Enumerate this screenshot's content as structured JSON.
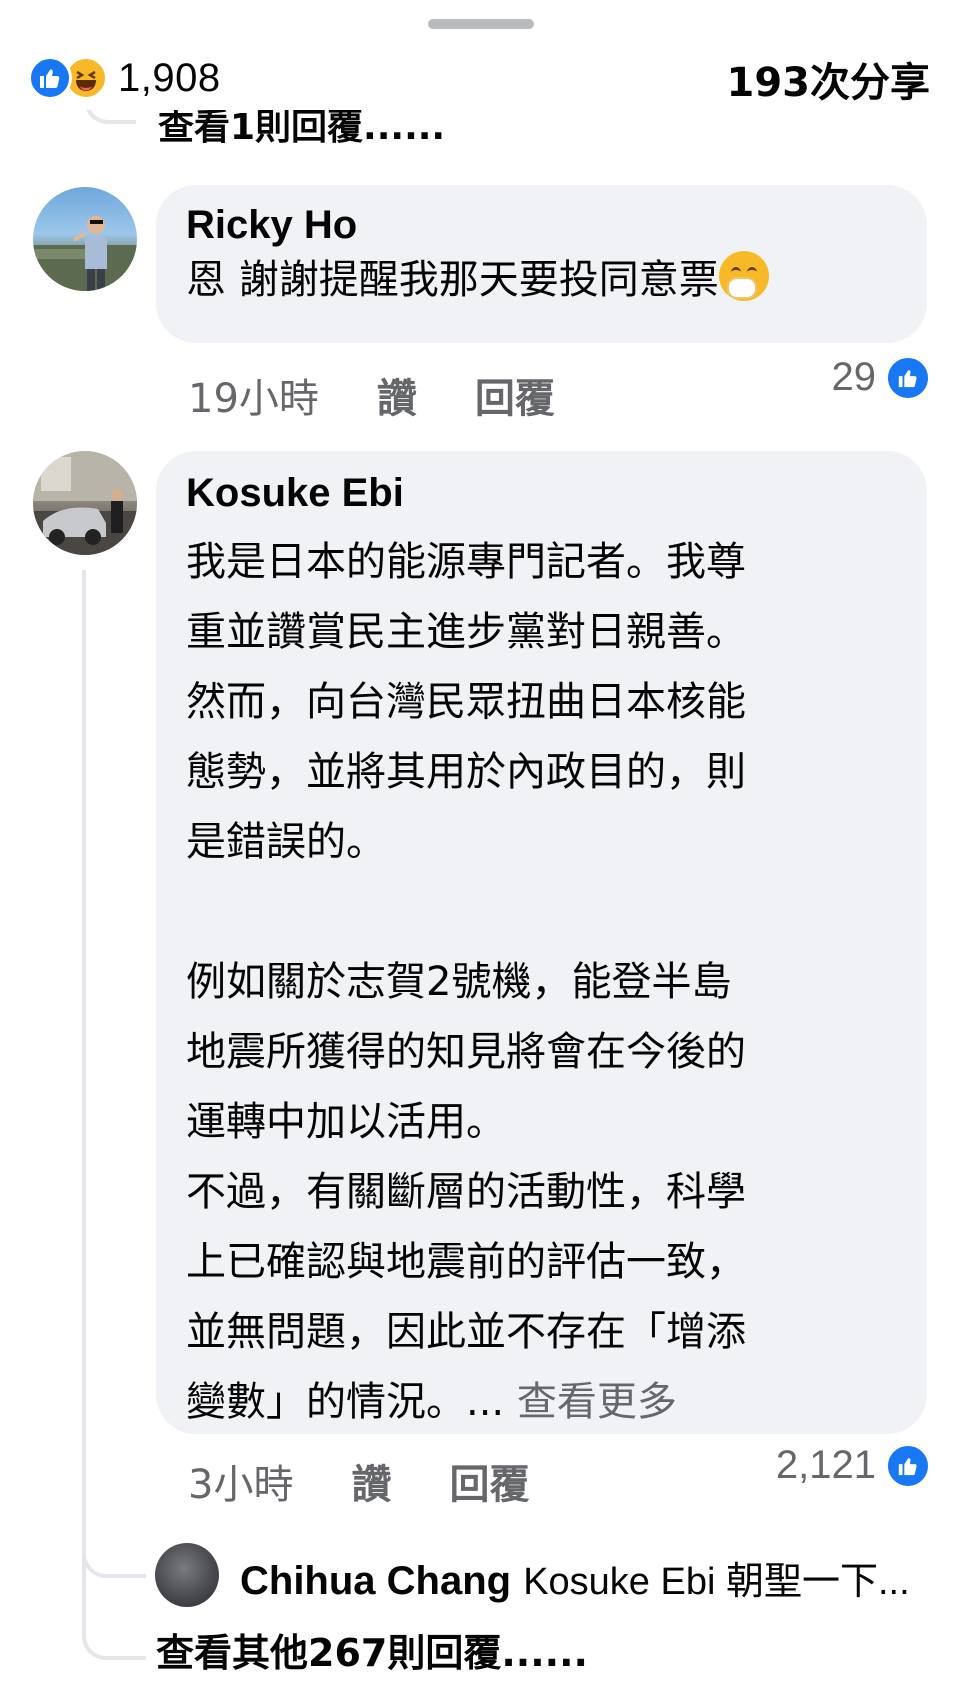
{
  "reactions": {
    "count": "1,908",
    "icons": [
      "like-icon",
      "haha-icon"
    ],
    "shares": "193次分享"
  },
  "partial_reply_link": "查看1則回覆......",
  "comments": [
    {
      "author": "Ricky Ho",
      "text": "恩 謝謝提醒我那天要投同意票",
      "emoji": "hand-over-mouth-emoji",
      "time": "19小時",
      "like_label": "讚",
      "reply_label": "回覆",
      "like_count": "29"
    },
    {
      "author": "Kosuke Ebi",
      "lines": [
        "我是日本的能源專門記者。我尊",
        "重並讚賞民主進步黨對日親善。",
        "然而，向台灣民眾扭曲日本核能",
        "態勢，並將其用於內政目的，則",
        "是錯誤的。",
        "",
        "例如關於志賀2號機，能登半島",
        "地震所獲得的知見將會在今後的",
        "運轉中加以活用。",
        "不過，有關斷層的活動性，科學",
        "上已確認與地震前的評估一致，",
        "並無問題，因此並不存在「增添",
        "變數」的情況。..."
      ],
      "see_more": "查看更多",
      "time": "3小時",
      "like_label": "讚",
      "reply_label": "回覆",
      "like_count": "2,121",
      "replies_preview": {
        "author": "Chihua Chang",
        "text": "Kosuke Ebi 朝聖一下..."
      },
      "more_replies": "查看其他267則回覆......"
    }
  ],
  "colors": {
    "like_blue": "#1877f2",
    "haha_yellow": "#f7b928",
    "bubble_bg": "#f0f2f5",
    "meta_gray": "#65676b"
  }
}
